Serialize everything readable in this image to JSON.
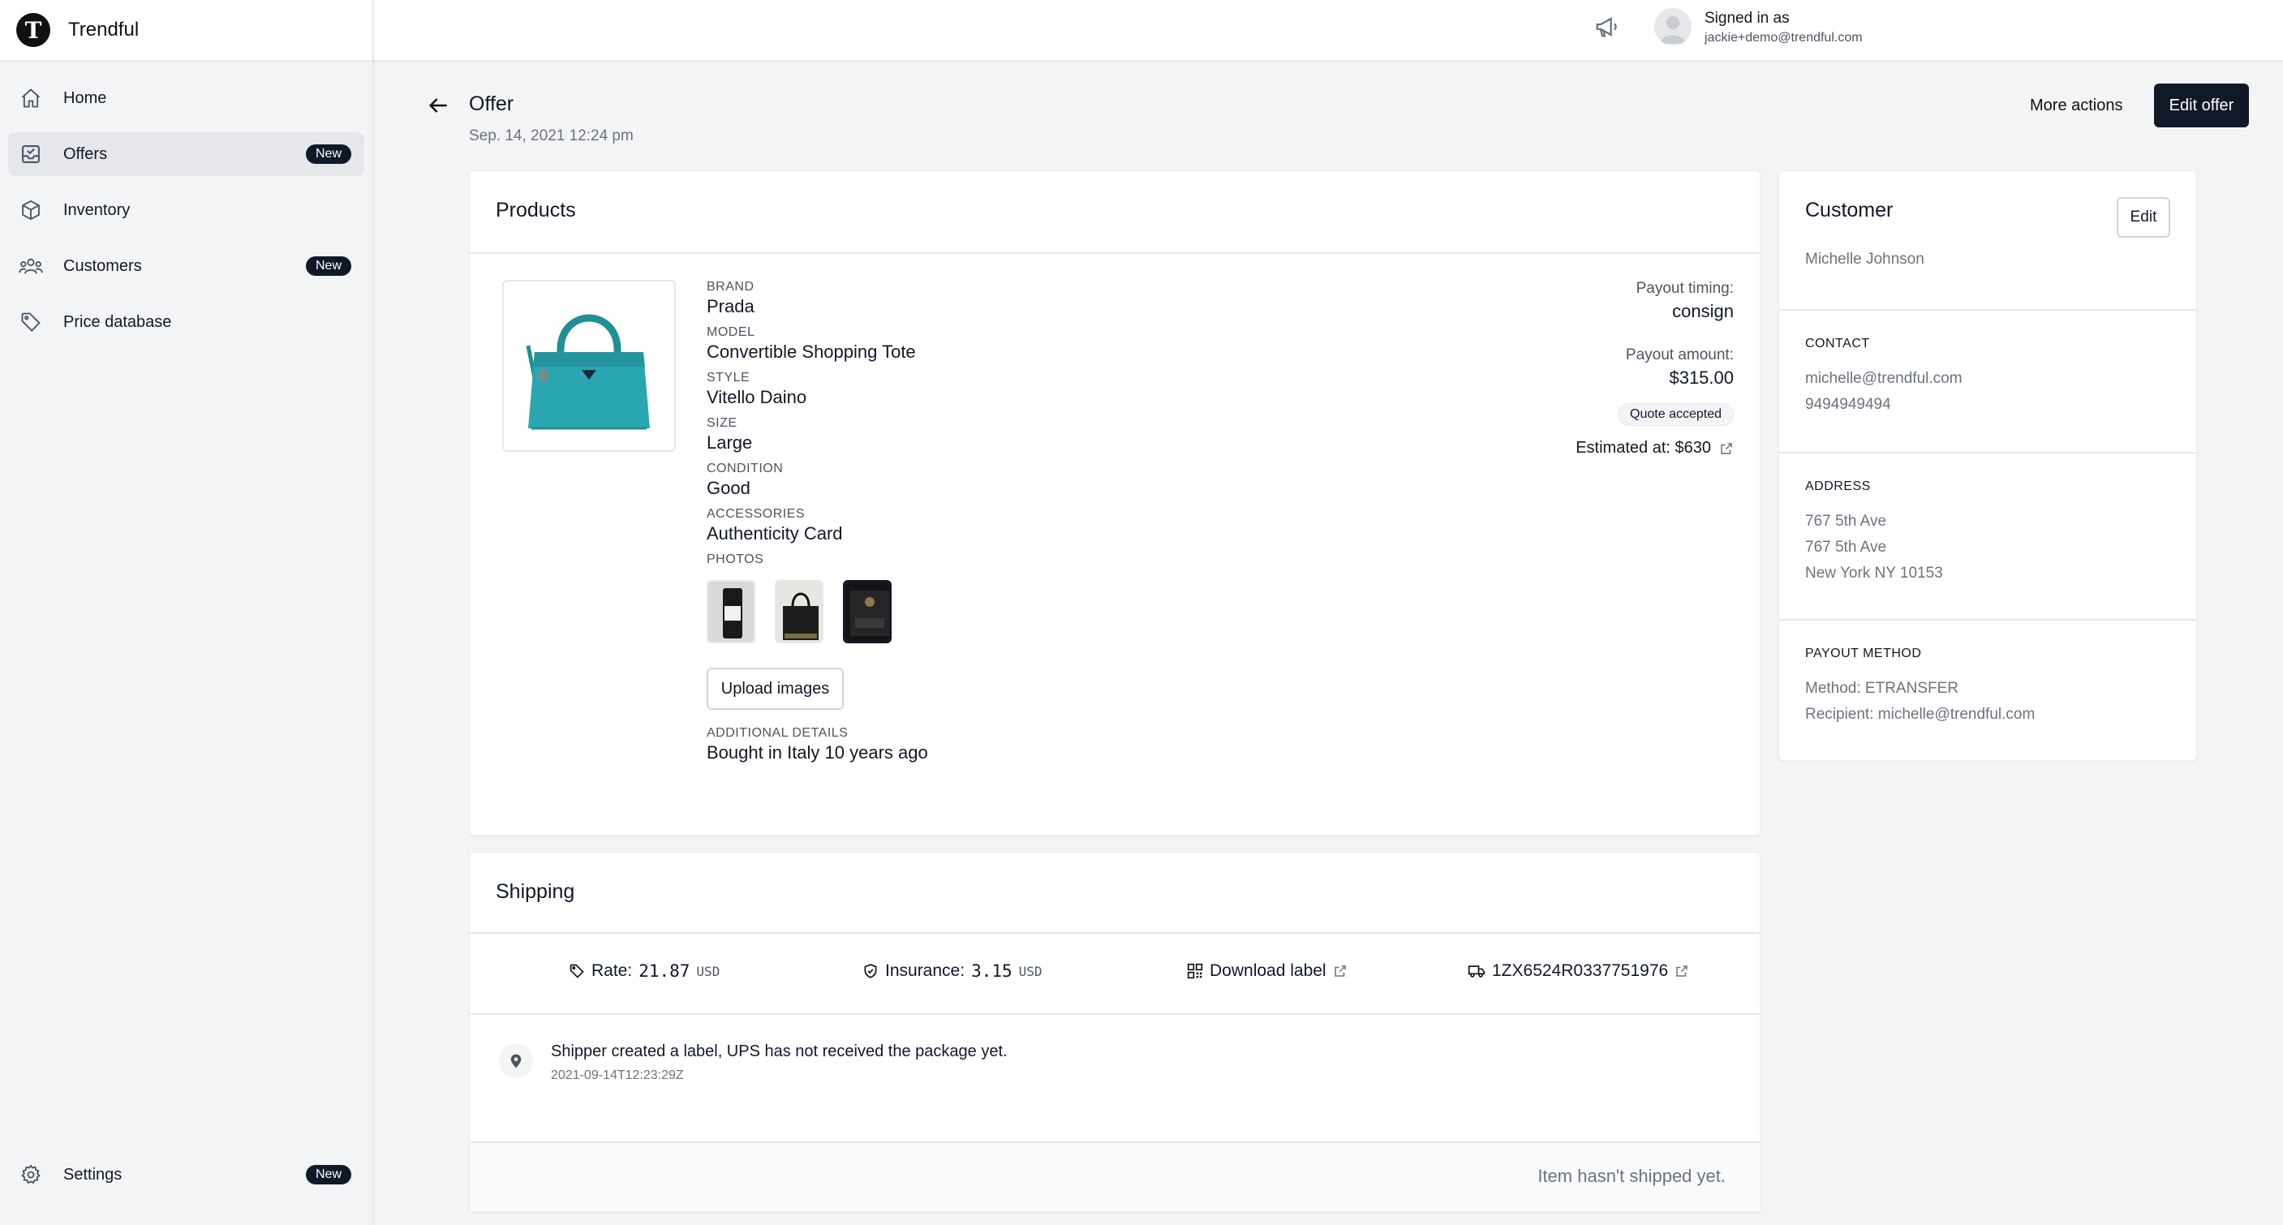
{
  "app": {
    "name": "Trendful",
    "logo_letter": "T"
  },
  "sidebar": {
    "items": [
      {
        "label": "Home",
        "icon": "home-icon",
        "badge": ""
      },
      {
        "label": "Offers",
        "icon": "inbox-icon",
        "badge": "New",
        "active": true
      },
      {
        "label": "Inventory",
        "icon": "cube-icon",
        "badge": ""
      },
      {
        "label": "Customers",
        "icon": "users-icon",
        "badge": "New"
      },
      {
        "label": "Price database",
        "icon": "tag-icon",
        "badge": ""
      }
    ],
    "settings": {
      "label": "Settings",
      "icon": "gear-icon",
      "badge": "New"
    }
  },
  "topbar": {
    "announce_icon": "megaphone-icon",
    "signed_in_label": "Signed in as",
    "email": "jackie+demo@trendful.com"
  },
  "page": {
    "title": "Offer",
    "date": "Sep. 14, 2021 12:24 pm",
    "more_actions": "More actions",
    "edit_offer": "Edit offer"
  },
  "products": {
    "title": "Products",
    "attributes": [
      {
        "label": "Brand",
        "value": "Prada"
      },
      {
        "label": "Model",
        "value": "Convertible Shopping Tote"
      },
      {
        "label": "Style",
        "value": "Vitello Daino"
      },
      {
        "label": "Size",
        "value": "Large"
      },
      {
        "label": "Condition",
        "value": "Good"
      },
      {
        "label": "Accessories",
        "value": "Authenticity Card"
      }
    ],
    "photos_label": "Photos",
    "upload_label": "Upload images",
    "additional_label": "Additional details",
    "additional_value": "Bought in Italy 10 years ago",
    "payout_timing_label": "Payout timing:",
    "payout_timing": "consign",
    "payout_amount_label": "Payout amount:",
    "payout_amount": "$315.00",
    "quote_status": "Quote accepted",
    "estimated": "Estimated at: $630"
  },
  "shipping": {
    "title": "Shipping",
    "rate_label": "Rate:",
    "rate_value": "21.87",
    "rate_currency": "USD",
    "insurance_label": "Insurance:",
    "insurance_value": "3.15",
    "insurance_currency": "USD",
    "download_label": "Download label",
    "tracking": "1ZX6524R0337751976",
    "event_text": "Shipper created a label, UPS has not received the package yet.",
    "event_time": "2021-09-14T12:23:29Z",
    "footer": "Item hasn't shipped yet."
  },
  "customer": {
    "title": "Customer",
    "edit_label": "Edit",
    "name": "Michelle Johnson",
    "contact_label": "Contact",
    "email": "michelle@trendful.com",
    "phone": "9494949494",
    "address_label": "Address",
    "address1": "767 5th Ave",
    "address2": "767 5th Ave",
    "address3": "New York NY 10153",
    "payout_label": "Payout method",
    "payout_method": "Method: ETRANSFER",
    "payout_recipient": "Recipient: michelle@trendful.com"
  },
  "colors": {
    "accent": "#111827",
    "bag": "#2aa6b0",
    "muted": "#6b7280"
  }
}
